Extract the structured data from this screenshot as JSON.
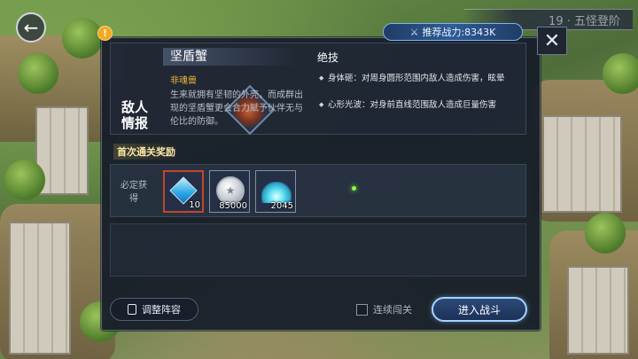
{
  "stage": {
    "title": "19 · 五怪登阶"
  },
  "power": {
    "label": "推荐战力:8343K"
  },
  "enemy": {
    "tag": "敌人情报",
    "name": "坚盾蟹",
    "type": "非魂兽",
    "description": "生来就拥有坚韧的外壳，而成群出现的坚盾蟹更会合力赋予伙伴无与伦比的防御。"
  },
  "skills": {
    "title": "绝技",
    "items": [
      {
        "text": "身体砸：对周身圆形范围内敌人造成伤害，眩晕"
      },
      {
        "text": "心形光波：对身前直线范围敌人造成巨量伤害"
      }
    ]
  },
  "rewards": {
    "header": "首次通关奖励",
    "label": "必定获得",
    "items": [
      {
        "icon": "diamond-icon",
        "qty": "10"
      },
      {
        "icon": "silver-coin-icon",
        "qty": "85000"
      },
      {
        "icon": "crystal-dust-icon",
        "qty": "2045"
      }
    ]
  },
  "buttons": {
    "adjust": "调整阵容",
    "continuous": "连续闯关",
    "battle": "进入战斗"
  },
  "colors": {
    "accent": "#a7d2ff",
    "gold": "#f0b73a",
    "panel": "#161c28"
  }
}
